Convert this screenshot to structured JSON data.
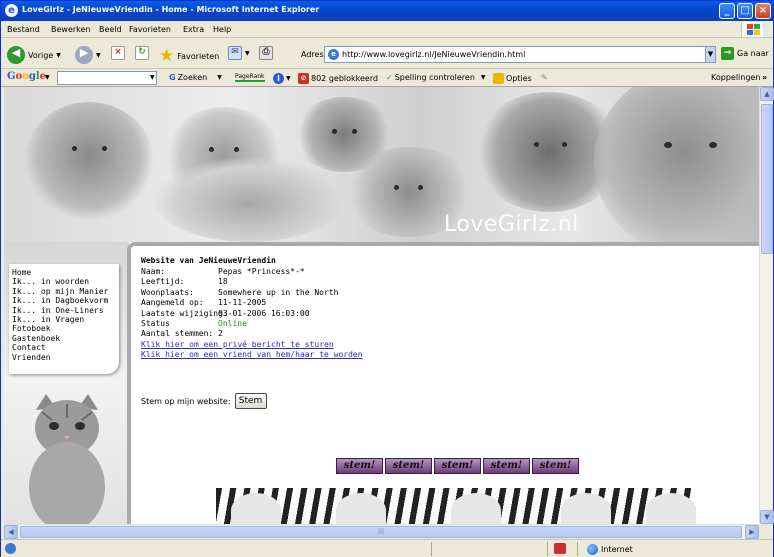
{
  "window": {
    "title": "LoveGirlz - JeNieuweVriendin - Home - Microsoft Internet Explorer"
  },
  "menu": [
    "Bestand",
    "Bewerken",
    "Beeld",
    "Favorieten",
    "Extra",
    "Help"
  ],
  "toolbar": {
    "back": "Vorige",
    "favorites": "Favorieten",
    "address_label": "Adres",
    "address_value": "http://www.lovegirlz.nl/JeNieuweVriendin.html",
    "go": "Ga naar"
  },
  "google_bar": {
    "logo": "Google",
    "search_btn": "Zoeken",
    "pagerank": "PageRank",
    "blocked": "802 geblokkeerd",
    "spelling": "Spelling controleren",
    "options": "Opties",
    "links": "Koppelingen"
  },
  "banner": {
    "title": "LoveGirlz.nl"
  },
  "nav": [
    "Home",
    "Ik... in woorden",
    "Ik... op mijn Manier",
    "Ik... in Dagboekvorm",
    "Ik... in One-Liners",
    "Ik... in Vragen",
    "Fotoboek",
    "Gastenboek",
    "Contact",
    "Vrienden"
  ],
  "profile": {
    "heading": "Website van JeNieuweVriendin",
    "fields": [
      {
        "label": "Naam:",
        "value": "Pepas *Princess*-*"
      },
      {
        "label": "Leeftijd:",
        "value": "18"
      },
      {
        "label": "Woonplaats:",
        "value": "Somewhere up in the North"
      },
      {
        "label": "Aangemeld op:",
        "value": "11-11-2005"
      },
      {
        "label": "Laatste wijziging:",
        "value": "03-01-2006 16:03:00"
      },
      {
        "label": "Status",
        "value": "Online"
      },
      {
        "label": "Aantal stemmen:",
        "value": "2"
      }
    ],
    "link_private": "Klik hier om een privé bericht te sturen",
    "link_friend": "Klik hier om een vriend van hem/haar te worden"
  },
  "vote": {
    "label": "Stem op mijn website:",
    "button": "Stem"
  },
  "stem_badges": [
    "stem!",
    "stem!",
    "stem!",
    "stem!",
    "stem!"
  ],
  "statusbar": {
    "zone": "Internet"
  },
  "colors": {
    "titlebar": "#0446cf",
    "online": "#1a8f1a",
    "link": "#2b2bbf",
    "stem_badge": "#6c3e7a"
  }
}
